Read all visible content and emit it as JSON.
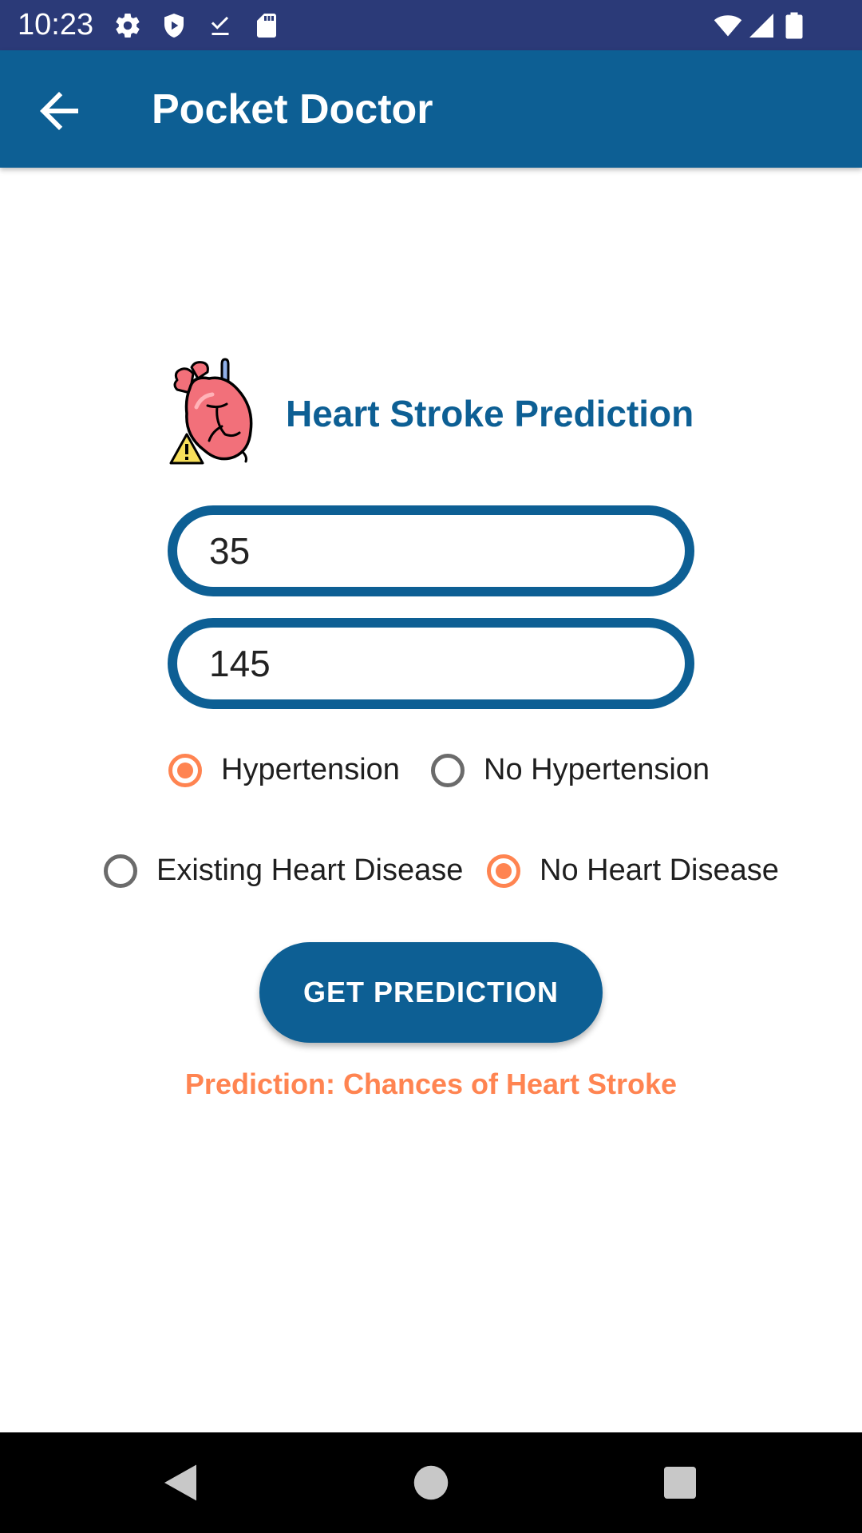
{
  "status_bar": {
    "time": "10:23",
    "left_icons": [
      "gear-icon",
      "shield-icon",
      "download-done-icon",
      "sd-card-icon"
    ],
    "right_icons": [
      "wifi-icon",
      "cell-signal-icon",
      "battery-icon"
    ]
  },
  "app_bar": {
    "title": "Pocket Doctor",
    "back_icon": "arrow-left-icon"
  },
  "header": {
    "icon": "heart-warning-icon",
    "title": "Heart Stroke Prediction"
  },
  "inputs": {
    "first_value": "35",
    "second_value": "145"
  },
  "hypertension_group": {
    "options": [
      {
        "label": "Hypertension",
        "checked": true
      },
      {
        "label": "No Hypertension",
        "checked": false
      }
    ]
  },
  "heart_disease_group": {
    "options": [
      {
        "label": "Existing Heart Disease",
        "checked": false
      },
      {
        "label": "No Heart Disease",
        "checked": true
      }
    ]
  },
  "actions": {
    "predict_label": "GET PREDICTION"
  },
  "result": {
    "text": "Prediction: Chances of Heart Stroke"
  },
  "nav_bar": {
    "buttons": [
      "back-triangle-icon",
      "home-circle-icon",
      "recents-square-icon"
    ]
  },
  "colors": {
    "status_bar": "#2b3a78",
    "primary": "#0d5f94",
    "accent": "#ff8451",
    "nav_bar": "#000000"
  }
}
